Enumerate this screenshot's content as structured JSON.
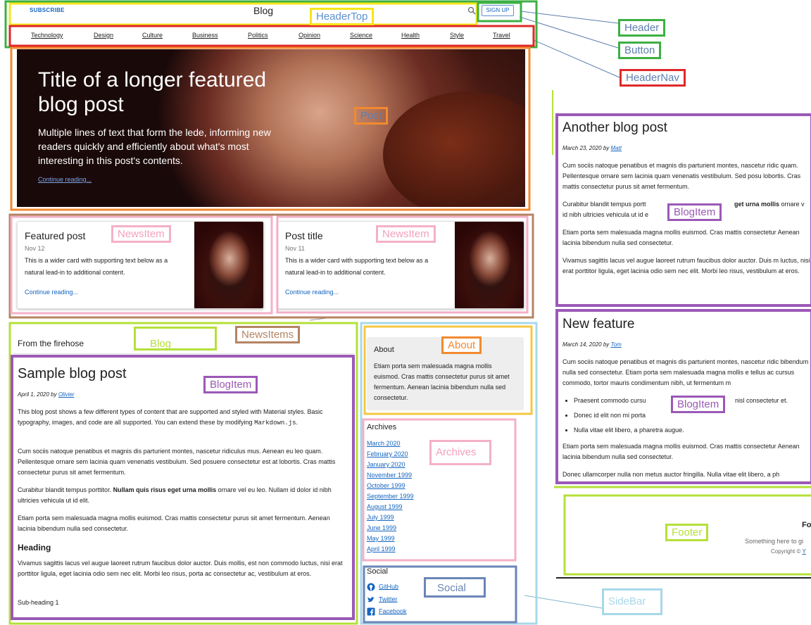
{
  "header": {
    "subscribe": "SUBSCRIBE",
    "brand": "Blog",
    "signup": "SIGN UP",
    "nav": [
      "Technology",
      "Design",
      "Culture",
      "Business",
      "Politics",
      "Opinion",
      "Science",
      "Health",
      "Style",
      "Travel"
    ]
  },
  "hero": {
    "title": "Title of a longer featured blog post",
    "lede": "Multiple lines of text that form the lede, informing new readers quickly and efficiently about what's most interesting in this post's contents.",
    "link": "Continue reading..."
  },
  "cards": [
    {
      "title": "Featured post",
      "date": "Nov 12",
      "text": "This is a wider card with supporting text below as a natural lead-in to additional content.",
      "link": "Continue reading..."
    },
    {
      "title": "Post title",
      "date": "Nov 11",
      "text": "This is a wider card with supporting text below as a natural lead-in to additional content.",
      "link": "Continue reading..."
    }
  ],
  "blog": {
    "heading": "From the firehose",
    "post": {
      "title": "Sample blog post",
      "date": "April 1, 2020 by ",
      "author": "Olivier",
      "p1_a": "This blog post shows a few different types of content that are supported and styled with Material styles. Basic typography, images, and code are all supported. You can extend these by modifying ",
      "p1_code": "Markdown.js",
      "p1_b": ".",
      "p2": "Cum sociis natoque penatibus et magnis dis parturient montes, nascetur ridiculus mus. Aenean eu leo quam. Pellentesque ornare sem lacinia quam venenatis vestibulum. Sed posuere consectetur est at lobortis. Cras mattis consectetur purus sit amet fermentum.",
      "p3_a": "Curabitur blandit tempus porttitor. ",
      "p3_bold": "Nullam quis risus eget urna mollis",
      "p3_b": " ornare vel eu leo. Nullam id dolor id nibh ultricies vehicula ut id elit.",
      "p4": "Etiam porta sem malesuada magna mollis euismod. Cras mattis consectetur purus sit amet fermentum. Aenean lacinia bibendum nulla sed consectetur.",
      "h": "Heading",
      "p5": "Vivamus sagittis lacus vel augue laoreet rutrum faucibus dolor auctor. Duis mollis, est non commodo luctus, nisi erat porttitor ligula, eget lacinia odio sem nec elit. Morbi leo risus, porta ac consectetur ac, vestibulum at eros.",
      "sub": "Sub-heading 1"
    }
  },
  "sidebar": {
    "about_title": "About",
    "about_text": "Etiam porta sem malesuada magna mollis euismod. Cras mattis consectetur purus sit amet fermentum. Aenean lacinia bibendum nulla sed consectetur.",
    "archives_title": "Archives",
    "archives": [
      "March 2020",
      "February 2020",
      "January 2020",
      "November 1999",
      "October 1999",
      "September 1999",
      "August 1999",
      "July 1999",
      "June 1999",
      "May 1999",
      "April 1999"
    ],
    "social_title": "Social",
    "social": [
      "GitHub",
      "Twitter",
      "Facebook"
    ]
  },
  "right_posts": [
    {
      "title": "Another blog post",
      "date": "March 23, 2020 by ",
      "author": "Matt",
      "p1": "Cum sociis natoque penatibus et magnis dis parturient montes, nascetur ridic quam. Pellentesque ornare sem lacinia quam venenatis vestibulum. Sed posu lobortis. Cras mattis consectetur purus sit amet fermentum.",
      "p2_a": "Curabitur blandit tempus portt",
      "p2_bold": "get urna mollis",
      "p2_b": " ornare v",
      "p2_c": "id nibh ultricies vehicula ut id e",
      "p3": "Etiam porta sem malesuada magna mollis euismod. Cras mattis consectetur Aenean lacinia bibendum nulla sed consectetur.",
      "p4": "Vivamus sagittis lacus vel augue laoreet rutrum faucibus dolor auctor. Duis m luctus, nisi erat porttitor ligula, eget lacinia odio sem nec elit. Morbi leo risus, vestibulum at eros."
    },
    {
      "title": "New feature",
      "date": "March 14, 2020 by ",
      "author": "Tom",
      "p1": "Cum sociis natoque penatibus et magnis dis parturient montes, nascetur ridic bibendum nulla sed consectetur. Etiam porta sem malesuada magna mollis e tellus ac cursus commodo, tortor mauris condimentum nibh, ut fermentum m",
      "li1": "Praesent commodo cursu",
      "li1_tail": "nisl consectetur et.",
      "li2": "Donec id elit non mi porta",
      "li3": "Nulla vitae elit libero, a pharetra augue.",
      "p2": "Etiam porta sem malesuada magna mollis euismod. Cras mattis consectetur Aenean lacinia bibendum nulla sed consectetur.",
      "p3": "Donec ullamcorper nulla non metus auctor fringilla. Nulla vitae elit libero, a ph"
    }
  ],
  "footer": {
    "title": "Fo",
    "text": "Something here to gi",
    "copyright": "Copyright © ",
    "copyright_link": "Y"
  },
  "labels": {
    "header": "Header",
    "header_top": "HeaderTop",
    "button": "Button",
    "header_nav": "HeaderNav",
    "post": "Post",
    "news_item_1": "NewsItem",
    "news_item_2": "NewsItem",
    "news_items": "NewsItems",
    "blog": "Blog",
    "blog_item_1": "BlogItem",
    "blog_item_2": "BlogItem",
    "blog_item_3": "BlogItem",
    "about": "About",
    "archives": "Archives",
    "social": "Social",
    "sidebar": "SideBar",
    "footer": "Footer"
  },
  "colors": {
    "header": "#3cb043",
    "header_top": "#f5e51b",
    "header_nav": "#e02828",
    "post": "#f28a30",
    "news_item": "#f4b0c8",
    "news_items": "#b58463",
    "blog": "#b5e03a",
    "blog_item": "#9b59b6",
    "about": "#f5c842",
    "social": "#6b86b8",
    "sidebar": "#a8d8ea",
    "footer": "#b5e03a"
  }
}
